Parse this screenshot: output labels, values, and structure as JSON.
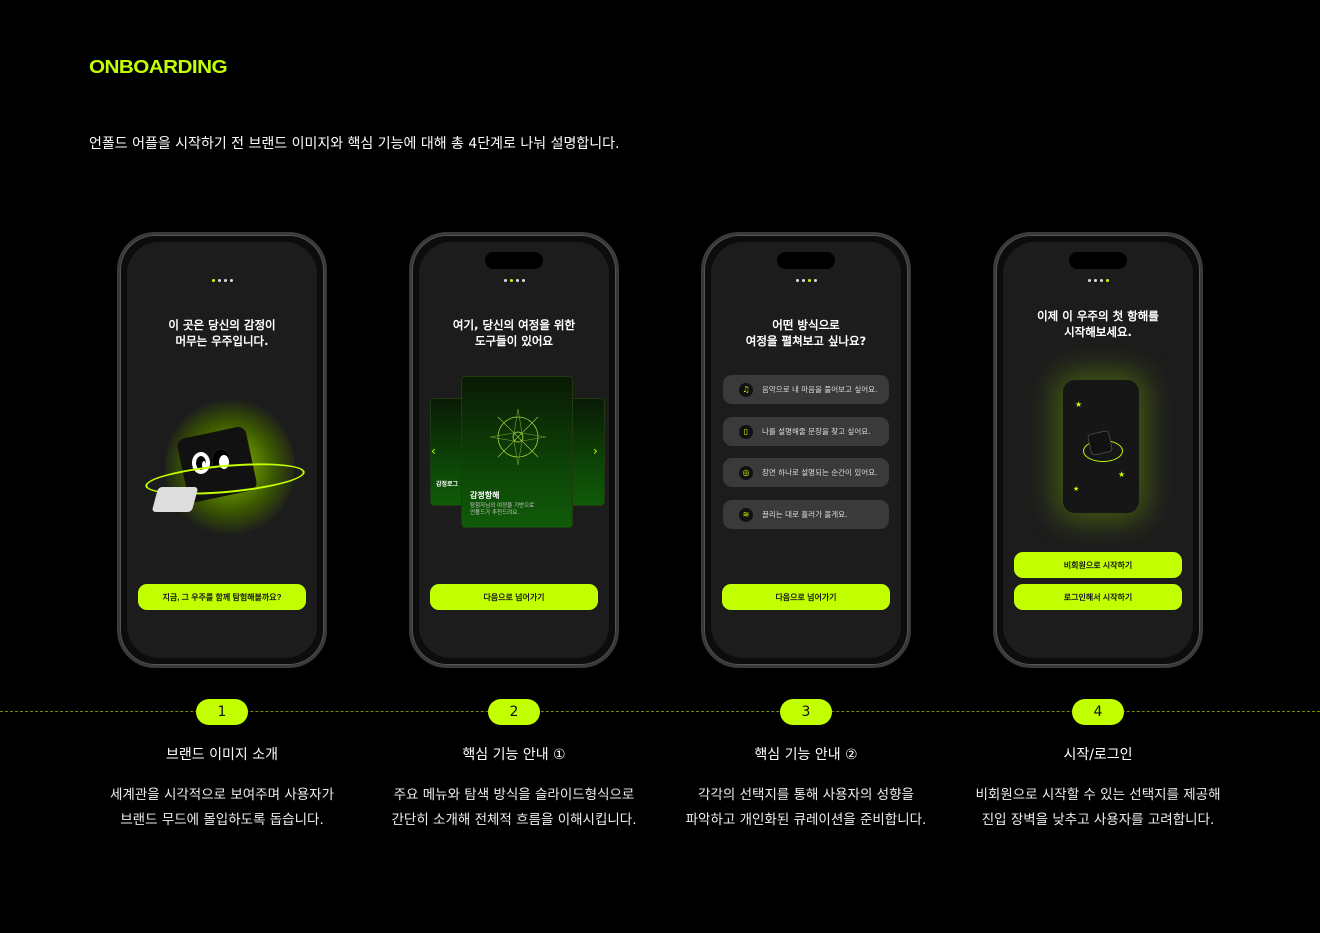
{
  "header": {
    "logo": "ONBOARDING",
    "intro": "언폴드 어플을 시작하기 전 브랜드 이미지와 핵심 기능에 대해 총 4단계로 나눠 설명합니다."
  },
  "colors": {
    "accent": "#c2ff00",
    "screen": "#1c1c1c"
  },
  "phones": [
    {
      "title1": "이 곳은 당신의 감정이",
      "title2": "머무는 우주입니다.",
      "cta": "지금, 그 우주를 함께 탐험해볼까요?"
    },
    {
      "title1": "여기, 당신의 여정을 위한",
      "title2": "도구들이 있어요",
      "cta": "다음으로 넘어가기",
      "card_title": "감정항해",
      "card_desc1": "탐험자님의 여정을 기반으로",
      "card_desc2": "언폴드가 추천드려요.",
      "side_card_title": "감정로그"
    },
    {
      "title1": "어떤 방식으로",
      "title2": "여정을 펼쳐보고 싶나요?",
      "cta": "다음으로 넘어가기",
      "options": [
        {
          "icon": "music-note-icon",
          "label": "음악으로 내 마음을 풀어보고 싶어요."
        },
        {
          "icon": "book-icon",
          "label": "나를 설명해줄 문장을 찾고 싶어요."
        },
        {
          "icon": "film-reel-icon",
          "label": "장면 하나로 설명되는 순간이 있어요."
        },
        {
          "icon": "flow-lines-icon",
          "label": "끌리는 대로 흘러가 볼게요."
        }
      ]
    },
    {
      "title1": "이제 이 우주의 첫 항해를",
      "title2": "시작해보세요.",
      "cta_guest": "비회원으로 시작하기",
      "cta_login": "로그인해서 시작하기"
    }
  ],
  "steps": [
    {
      "num": "1",
      "title": "브랜드 이미지 소개",
      "desc1": "세계관을 시각적으로 보여주며 사용자가",
      "desc2": "브랜드 무드에 몰입하도록 돕습니다."
    },
    {
      "num": "2",
      "title": "핵심 기능 안내 ①",
      "desc1": "주요 메뉴와 탐색 방식을 슬라이드형식으로",
      "desc2": "간단히 소개해 전체적 흐름을 이해시킵니다."
    },
    {
      "num": "3",
      "title": "핵심 기능 안내 ②",
      "desc1": "각각의 선택지를 통해 사용자의 성향을",
      "desc2": "파악하고 개인화된 큐레이션을 준비합니다."
    },
    {
      "num": "4",
      "title": "시작/로그인",
      "desc1": "비회원으로 시작할 수 있는 선택지를 제공해",
      "desc2": "진입 장벽을 낮추고 사용자를 고려합니다."
    }
  ]
}
